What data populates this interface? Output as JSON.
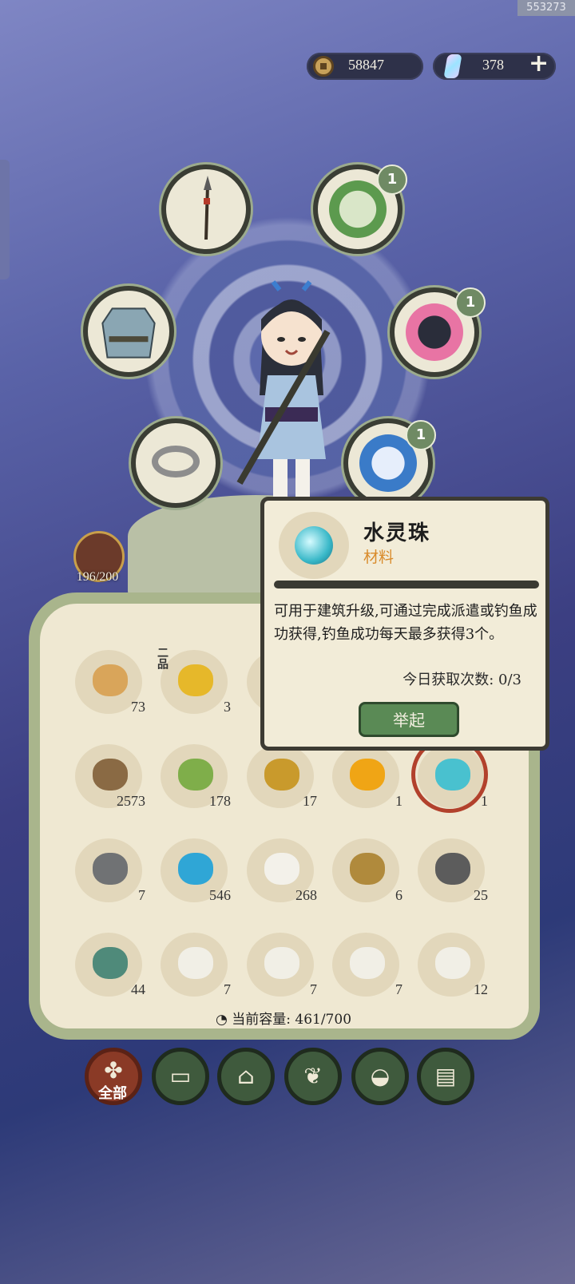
{
  "watermark": "553273",
  "currency": {
    "coins": "58847",
    "gems": "378"
  },
  "stamina": "196/200",
  "equipment_slots": [
    {
      "icon": "spear-icon"
    },
    {
      "icon": "companion-elder-icon",
      "badge": "1"
    },
    {
      "icon": "armor-icon"
    },
    {
      "icon": "companion-jackal-icon",
      "badge": "1"
    },
    {
      "icon": "ring-icon"
    },
    {
      "icon": "companion-spirit-icon",
      "badge": "1"
    }
  ],
  "inventory": [
    {
      "icon": "scroll-icon",
      "count": "73"
    },
    {
      "icon": "golden-fruit-icon",
      "count": "3",
      "grade": "二品"
    },
    {
      "icon": "hidden-item-icon",
      "count": ""
    },
    {
      "icon": "hidden-item-icon",
      "count": ""
    },
    {
      "icon": "hidden-item-icon",
      "count": ""
    },
    {
      "icon": "wood-log-icon",
      "count": "2573"
    },
    {
      "icon": "bamboo-icon",
      "count": "178"
    },
    {
      "icon": "golden-herb-icon",
      "count": "17"
    },
    {
      "icon": "fire-orb-icon",
      "count": "1"
    },
    {
      "icon": "water-orb-icon",
      "count": "1"
    },
    {
      "icon": "iron-ingot-icon",
      "count": "7"
    },
    {
      "icon": "blue-flame-orb-icon",
      "count": "546"
    },
    {
      "icon": "white-stone-icon",
      "count": "268"
    },
    {
      "icon": "token-icon",
      "count": "6"
    },
    {
      "icon": "ore-rock-icon",
      "count": "25"
    },
    {
      "icon": "jade-ore-icon",
      "count": "44"
    },
    {
      "icon": "chicken-dumpling-icon",
      "count": "7"
    },
    {
      "icon": "ghost-dumpling-icon",
      "count": "7"
    },
    {
      "icon": "duck-dumpling-icon",
      "count": "7"
    },
    {
      "icon": "pig-dumpling-icon",
      "count": "12"
    }
  ],
  "capacity": "当前容量: 461/700",
  "tabs": [
    {
      "label": "全部",
      "icon": "grid-icon",
      "active": true
    },
    {
      "label": "",
      "icon": "log-icon"
    },
    {
      "label": "",
      "icon": "house-icon"
    },
    {
      "label": "",
      "icon": "leaf-icon"
    },
    {
      "label": "",
      "icon": "bowl-icon"
    },
    {
      "label": "",
      "icon": "scroll-tab-icon"
    }
  ],
  "tooltip": {
    "name": "水灵珠",
    "category": "材料",
    "description": "可用于建筑升级,可通过完成派遣或钓鱼成功获得,钓鱼成功每天最多获得3个。",
    "daily_count": "今日获取次数: 0/3",
    "button": "举起"
  }
}
